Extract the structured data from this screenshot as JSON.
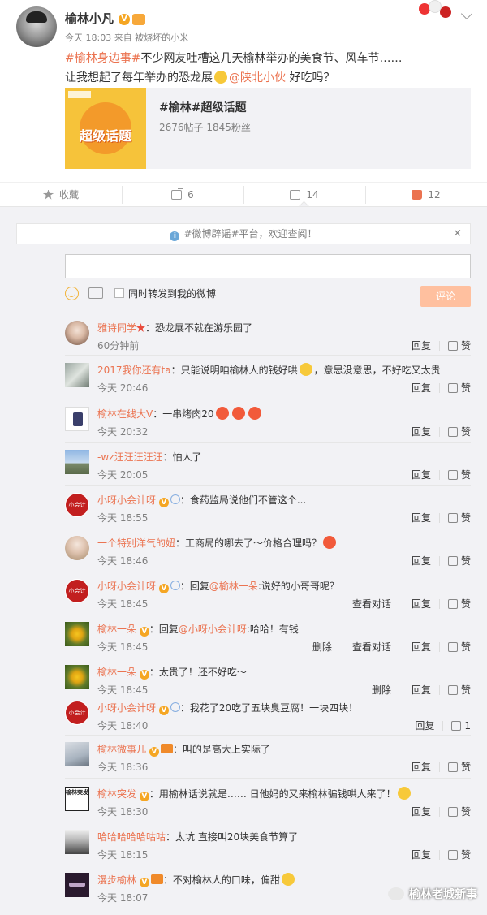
{
  "post": {
    "author": "榆林小凡",
    "meta": "今天 18:03 来自 被烧坏的小米",
    "text": {
      "topic": "#榆林身边事#",
      "line1": "不少网友吐槽这几天榆林举办的美食节、风车节……",
      "line2": "让我想起了每年举办的恐龙展",
      "mention": "@陕北小伙",
      "line2_end": " 好吃吗？"
    },
    "card": {
      "title": "#榆林#超级话题",
      "stats": "2676帖子 1845粉丝",
      "image_text": "超级话题"
    }
  },
  "actions": {
    "collect": "收藏",
    "share": "6",
    "comment": "14",
    "like": "12"
  },
  "comment_panel": {
    "notice": "#微博辟谣#平台，欢迎查阅！",
    "notice_close": "×",
    "sync_label": "同时转发到我的微博",
    "submit": "评论",
    "reply": "回复",
    "like": "赞",
    "view_dialog": "查看对话",
    "delete": "删除"
  },
  "comments": [
    {
      "name": "雅诗同学",
      "text": "：恐龙展不就在游乐园了",
      "time": "60分钟前"
    },
    {
      "name": "2017我你还有ta",
      "text": "：只能说明咱榆林人的钱好哄",
      "text2": "，意思没意思，不好吃又太贵",
      "time": "今天 20:46"
    },
    {
      "name": "榆林在线大V",
      "text": "：一串烤肉20",
      "time": "今天 20:32"
    },
    {
      "name": "-wz汪汪汪汪汪",
      "text": "：怕人了",
      "time": "今天 20:05"
    },
    {
      "name": "小呀小会计呀",
      "text": "：食药监局说他们不管这个...",
      "time": "今天 18:55"
    },
    {
      "name": "一个特别洋气的妞",
      "text": "：工商局的哪去了～价格合理吗？",
      "time": "今天 18:46"
    },
    {
      "name": "小呀小会计呀",
      "text": "：回复",
      "mention": "@榆林一朵",
      "text2": ":说好的小哥哥呢？",
      "time": "今天 18:45"
    },
    {
      "name": "榆林一朵",
      "text": "：回复",
      "mention": "@小呀小会计呀",
      "text2": ":哈哈！有钱",
      "time": "今天 18:45"
    },
    {
      "name": "榆林一朵",
      "text": "：太贵了！还不好吃～",
      "time": "今天 18:45"
    },
    {
      "name": "小呀小会计呀",
      "text": "：我花了20吃了五块臭豆腐！一块四块！",
      "time": "今天 18:40",
      "likes": "1"
    },
    {
      "name": "榆林微事儿",
      "text": "：叫的是高大上实际了",
      "time": "今天 18:36"
    },
    {
      "name": "榆林突发",
      "text": "：用榆林话说就是…… 日他妈的又来榆林骗钱哄人来了！",
      "time": "今天 18:30",
      "avatar_text": "榆林突发"
    },
    {
      "name": "哈哈哈哈哈咕咕",
      "text": "：太坑  直接叫20块美食节算了",
      "time": "今天 18:15"
    },
    {
      "name": "漫步榆林",
      "text": "：不对榆林人的口味，偏甜",
      "time": "今天 18:07"
    }
  ],
  "watermark": "榆林老城新事",
  "colors": {
    "accent": "#eb7350",
    "panel_bg": "#f2f2f5",
    "verified": "#f5a623",
    "submit_disabled": "#ffc09f"
  }
}
